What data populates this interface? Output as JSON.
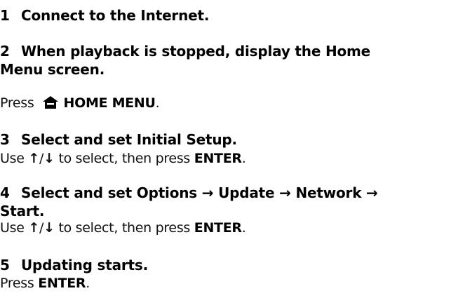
{
  "steps": [
    {
      "number": "1",
      "title": "Connect to the Internet."
    },
    {
      "number": "2",
      "title_line1": "When playback is stopped, display the Home",
      "title_line2": "Menu screen.",
      "body_prefix": "Press",
      "body_icon": "home-icon",
      "body_button": "HOME MENU",
      "body_suffix": "."
    },
    {
      "number": "3",
      "title": "Select and set Initial Setup.",
      "body_prefix": "Use",
      "arrow_up": "↑",
      "arrow_sep": "/",
      "arrow_down": "↓",
      "body_middle": "to select, then press",
      "body_button": "ENTER",
      "body_suffix": "."
    },
    {
      "number": "4",
      "title_line1": "Select and set Options → Update → Network →",
      "title_line2": "Start.",
      "body_prefix": "Use",
      "arrow_up": "↑",
      "arrow_sep": "/",
      "arrow_down": "↓",
      "body_middle": "to select, then press",
      "body_button": "ENTER",
      "body_suffix": "."
    },
    {
      "number": "5",
      "title": "Updating starts.",
      "body_prefix": "Press",
      "body_button": "ENTER",
      "body_suffix": "."
    }
  ]
}
